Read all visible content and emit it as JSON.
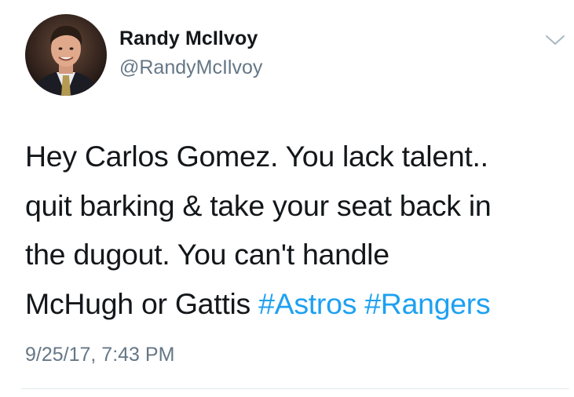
{
  "author": {
    "display_name": "Randy McIlvoy",
    "handle": "@RandyMcIlvoy",
    "avatar_icon": "profile-photo"
  },
  "menu": {
    "icon": "chevron-down-icon"
  },
  "tweet": {
    "line1": "Hey Carlos Gomez. You lack talent..",
    "line2": "quit barking &  take your seat back in",
    "line3": "the dugout. You can't handle",
    "line4_text": "McHugh or Gattis ",
    "hashtags": [
      "#Astros",
      "#Rangers"
    ]
  },
  "timestamp": "9/25/17, 7:43 PM",
  "colors": {
    "text": "#14171a",
    "secondary": "#657786",
    "link": "#1da1f2",
    "divider": "#e1e8ed"
  }
}
